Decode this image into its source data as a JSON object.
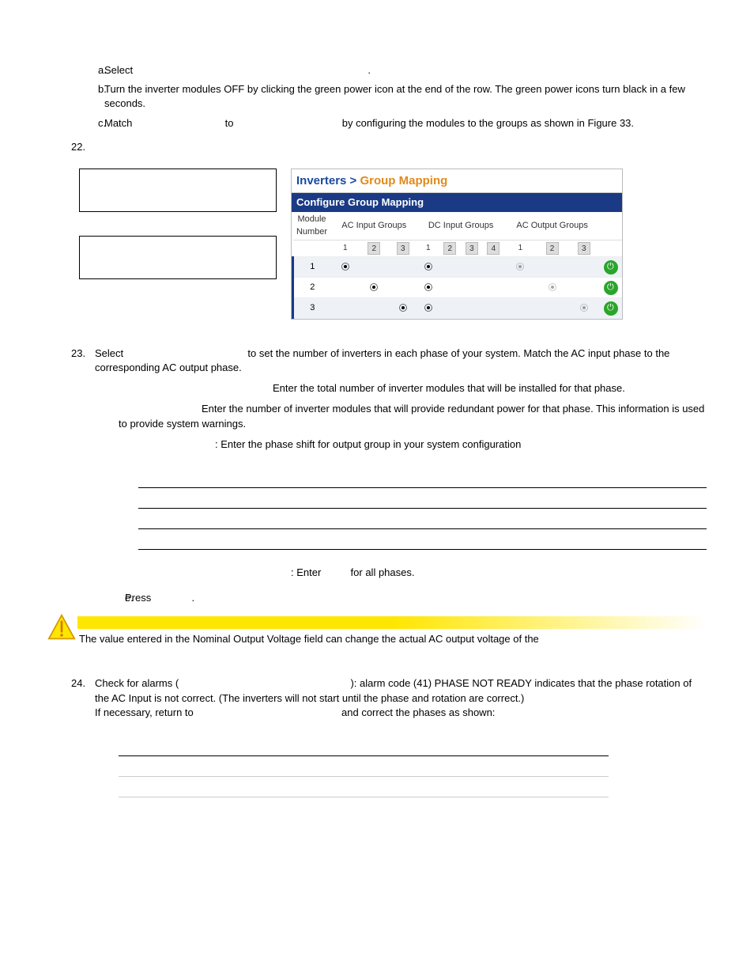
{
  "steps": {
    "a": {
      "marker": "a.",
      "text": "Select"
    },
    "a_trail": ".",
    "b": {
      "marker": "b.",
      "text": "Turn the inverter modules OFF by clicking the green power icon at the end of the row. The green power icons turn black in a few seconds."
    },
    "c": {
      "marker": "c.",
      "pre": "Match",
      "mid": "to",
      "post": "by configuring the modules to the groups as shown in Figure 33."
    }
  },
  "step22": {
    "marker": "22."
  },
  "group_mapping": {
    "title_pre": "Inverters > ",
    "title_orange": "Group Mapping",
    "subtitle": "Configure Group Mapping",
    "headers": {
      "mod": "Module Number",
      "acin": "AC Input Groups",
      "dcin": "DC Input Groups",
      "acout": "AC Output Groups"
    },
    "acin_nums": [
      "1",
      "2",
      "3"
    ],
    "dcin_nums": [
      "1",
      "2",
      "3",
      "4"
    ],
    "acout_nums": [
      "1",
      "2",
      "3"
    ],
    "rows": [
      {
        "mod": "1",
        "acin": 0,
        "dcin": 0,
        "acout": 0
      },
      {
        "mod": "2",
        "acin": 1,
        "dcin": 0,
        "acout": 1
      },
      {
        "mod": "3",
        "acin": 2,
        "dcin": 0,
        "acout": 2
      }
    ]
  },
  "step23": {
    "marker": "23.",
    "text_pre": "Select",
    "text_post": "to set the number of inverters in each phase of your system. Match the AC input phase to the corresponding AC output phase.",
    "para1": "Enter the total number of inverter modules that will be installed for that phase.",
    "para2": "Enter the number of inverter modules that will provide redundant power for that phase. This information is used to provide system warnings.",
    "para3": ": Enter the phase shift for output group in your system configuration",
    "para4_pre": ": Enter",
    "para4_post": "for all phases."
  },
  "estep": {
    "marker": "e.",
    "pre": "Press",
    "post": "."
  },
  "caution": {
    "text": "The value entered in the Nominal Output Voltage field can change the actual AC output voltage of the"
  },
  "step24": {
    "marker": "24.",
    "line1_pre": "Check for alarms (",
    "line1_post": "): alarm code (41) PHASE NOT READY indicates that the phase rotation of the AC Input is not correct. (The inverters will not start until the phase and rotation are correct.)",
    "line2_pre": "If necessary, return to",
    "line2_post": "and correct the phases as shown:"
  }
}
